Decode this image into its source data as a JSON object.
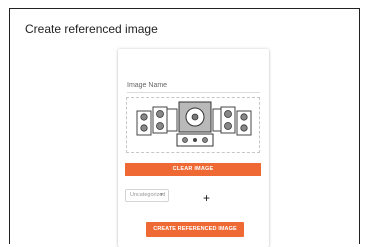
{
  "dialog": {
    "title": "Create referenced image"
  },
  "form": {
    "image_name_label": "Image Name",
    "image_preview_icon": "speaker-system-image",
    "clear_button_label": "CLEAR IMAGE",
    "category_select_value": "Uncategorized",
    "add_category_label": "+",
    "create_button_label": "CREATE REFERENCED IMAGE"
  },
  "colors": {
    "accent": "#ef6935",
    "border": "#222222"
  }
}
